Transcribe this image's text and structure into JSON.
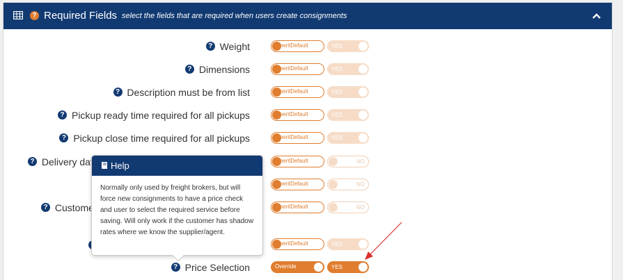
{
  "header": {
    "title": "Required Fields",
    "subtitle": "select the fields that are required when users create consignments",
    "grid_icon": "table-icon",
    "help_icon": "question-circle-icon",
    "collapse_icon": "chevron-up-icon"
  },
  "rows": [
    {
      "label": "Weight",
      "mode": "InheritDefault",
      "value": "YES"
    },
    {
      "label": "Dimensions",
      "mode": "InheritDefault",
      "value": "YES"
    },
    {
      "label": "Description must be from list",
      "mode": "InheritDefault",
      "value": "YES"
    },
    {
      "label": "Pickup ready time required for all pickups",
      "mode": "InheritDefault",
      "value": "YES"
    },
    {
      "label": "Pickup close time required for all pickups",
      "mode": "InheritDefault",
      "value": "YES"
    },
    {
      "label": "Delivery dat",
      "mode": "InheritDefault",
      "value": "NO"
    },
    {
      "label": "",
      "mode": "InheritDefault",
      "value": "NO"
    },
    {
      "label": "Customer",
      "mode": "InheritDefault",
      "value": "NO"
    },
    {
      "label": "",
      "mode": "InheritDefault",
      "value": "YES"
    },
    {
      "label": "Price Selection",
      "mode": "Override",
      "value": "YES"
    }
  ],
  "tooltip": {
    "title": "Help",
    "body": "Normally only used by freight brokers, but will force new consignments to have a price check and user to select the required service before saving. Will only work if the customer has shadow rates where we know the supplier/agent."
  },
  "colors": {
    "header_bg": "#123a72",
    "accent": "#e07d2e",
    "accent_light": "#f6dcc7",
    "annotation_arrow": "#d9302c"
  }
}
